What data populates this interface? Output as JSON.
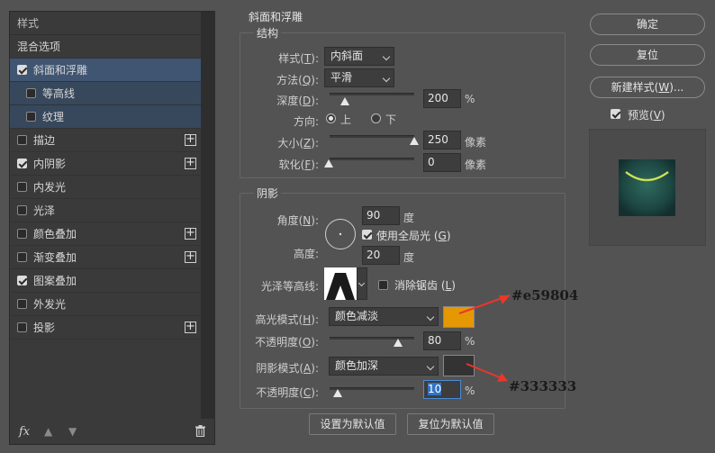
{
  "left_panel": {
    "header": "样式",
    "items": [
      {
        "label": "混合选项",
        "checkbox": false,
        "checked": false,
        "plus": false,
        "state": "normal",
        "indent": false
      },
      {
        "label": "斜面和浮雕",
        "checkbox": true,
        "checked": true,
        "plus": false,
        "state": "selected",
        "indent": false
      },
      {
        "label": "等高线",
        "checkbox": true,
        "checked": false,
        "plus": false,
        "state": "sub",
        "indent": true
      },
      {
        "label": "纹理",
        "checkbox": true,
        "checked": false,
        "plus": false,
        "state": "sub",
        "indent": true
      },
      {
        "label": "描边",
        "checkbox": true,
        "checked": false,
        "plus": true,
        "state": "normal",
        "indent": false
      },
      {
        "label": "内阴影",
        "checkbox": true,
        "checked": true,
        "plus": true,
        "state": "normal",
        "indent": false
      },
      {
        "label": "内发光",
        "checkbox": true,
        "checked": false,
        "plus": false,
        "state": "normal",
        "indent": false
      },
      {
        "label": "光泽",
        "checkbox": true,
        "checked": false,
        "plus": false,
        "state": "normal",
        "indent": false
      },
      {
        "label": "颜色叠加",
        "checkbox": true,
        "checked": false,
        "plus": true,
        "state": "normal",
        "indent": false
      },
      {
        "label": "渐变叠加",
        "checkbox": true,
        "checked": false,
        "plus": true,
        "state": "normal",
        "indent": false
      },
      {
        "label": "图案叠加",
        "checkbox": true,
        "checked": true,
        "plus": false,
        "state": "normal",
        "indent": false
      },
      {
        "label": "外发光",
        "checkbox": true,
        "checked": false,
        "plus": false,
        "state": "normal",
        "indent": false
      },
      {
        "label": "投影",
        "checkbox": true,
        "checked": false,
        "plus": true,
        "state": "normal",
        "indent": false
      }
    ],
    "footer": {
      "fx_label": "fx"
    }
  },
  "bevel": {
    "title": "斜面和浮雕",
    "structure": {
      "title": "结构",
      "style_label": "样式(",
      "style_key": "T",
      "style_value": "内斜面",
      "method_label": "方法(",
      "method_key": "Q",
      "method_value": "平滑",
      "depth_label": "深度(",
      "depth_key": "D",
      "depth_value": "200",
      "depth_unit": "%",
      "direction_label": "方向:",
      "dir_up": "上",
      "dir_down": "下",
      "size_label": "大小(",
      "size_key": "Z",
      "size_value": "250",
      "size_unit": "像素",
      "soften_label": "软化(",
      "soften_key": "F",
      "soften_value": "0",
      "soften_unit": "像素"
    },
    "shading": {
      "title": "阴影",
      "angle_label": "角度(",
      "angle_key": "N",
      "angle_value": "90",
      "angle_unit": "度",
      "global_light_label": "使用全局光 (",
      "global_light_key": "G",
      "altitude_label": "高度:",
      "altitude_value": "20",
      "altitude_unit": "度",
      "gloss_label": "光泽等高线:",
      "antialias_label": "消除锯齿 (",
      "antialias_key": "L",
      "highlight_label": "高光模式(",
      "highlight_key": "H",
      "highlight_mode": "颜色减淡",
      "highlight_opacity_label": "不透明度(",
      "highlight_opacity_key": "O",
      "highlight_opacity": "80",
      "highlight_opacity_unit": "%",
      "shadow_label": "阴影模式(",
      "shadow_key": "A",
      "shadow_mode": "颜色加深",
      "shadow_opacity_label": "不透明度(",
      "shadow_opacity_key": "C",
      "shadow_opacity": "10",
      "shadow_opacity_unit": "%"
    },
    "buttons": {
      "make_default": "设置为默认值",
      "reset_default": "复位为默认值"
    }
  },
  "right": {
    "ok": "确定",
    "reset": "复位",
    "new_style": "新建样式(",
    "new_style_key": "W",
    "new_style_suffix": ")...",
    "preview_label": "预览(",
    "preview_key": "V"
  },
  "colors": {
    "highlight": "#e59804",
    "shadow": "#333333",
    "annotation_arrow": "#e8372b"
  },
  "annotations": {
    "highlight_hex": "#e59804",
    "shadow_hex": "#333333"
  }
}
